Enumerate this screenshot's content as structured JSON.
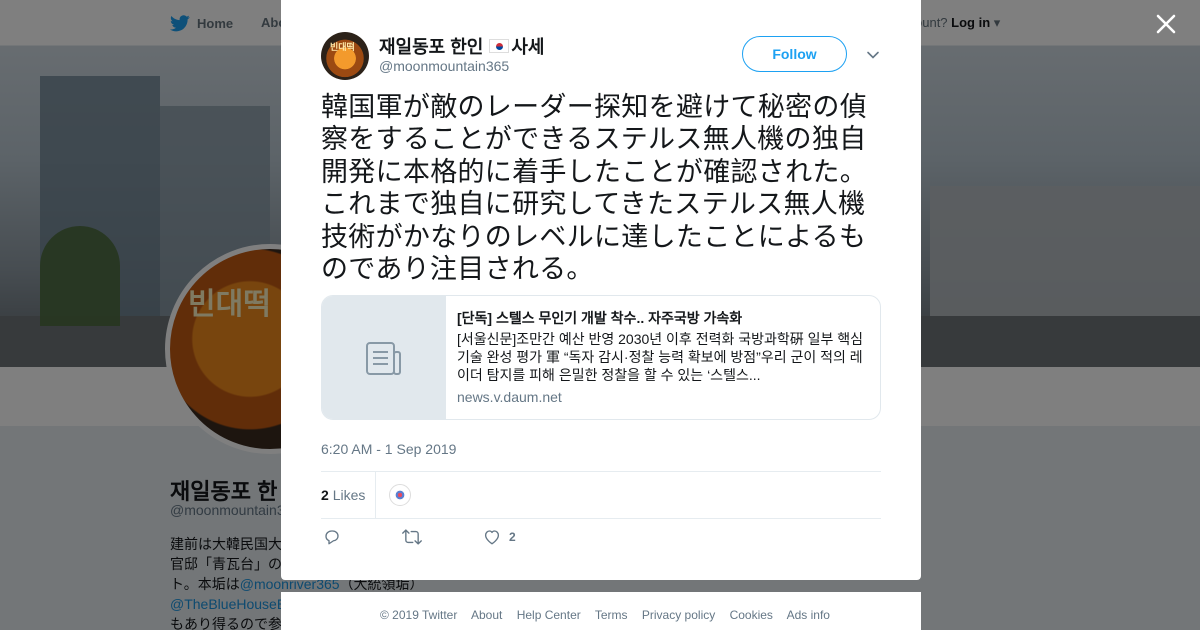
{
  "nav": {
    "home_label": "Home",
    "about_label": "Abo",
    "account_prompt": "ccount?",
    "login_label": "Log in"
  },
  "profile": {
    "display_name": "재일동포 한",
    "handle": "@moonmountain3",
    "bio_lines": [
      "建前は大韓民国大",
      "官邸「青瓦台」の",
      "ト。本垢は"
    ],
    "bio_link1": "@moonriver365",
    "bio_after_link1": "（大統領垢）",
    "bio_link2": "@TheBlueHouseE",
    "bio_last": "もあり得るので参"
  },
  "tweet": {
    "author_name": "재일동포 한인",
    "author_name_suffix": "사세",
    "author_handle": "@moonmountain365",
    "follow_label": "Follow",
    "text": "韓国軍が敵のレーダー探知を避けて秘密の偵察をすることができるステルス無人機の独自開発に本格的に着手したことが確認された。これまで独自に研究してきたステルス無人機技術がかなりのレベルに達したことによるものであり注目される。",
    "card": {
      "title": "[단독] 스텔스 무인기 개발 착수.. 자주국방 가속화",
      "description": "[서울신문]조만간 예산 반영 2030년 이후 전력화 국방과학硏 일부 핵심기술 완성 평가 軍 “독자 감시·정찰 능력 확보에 방점”우리 군이 적의 레이더 탐지를 피해 은밀한 정찰을 할 수 있는 ‘스텔스...",
      "domain": "news.v.daum.net"
    },
    "timestamp": "6:20 AM - 1 Sep 2019",
    "likes_count": "2",
    "likes_label": "Likes",
    "like_action_count": "2"
  },
  "footer": {
    "copyright": "© 2019 Twitter",
    "links": [
      "About",
      "Help Center",
      "Terms",
      "Privacy policy",
      "Cookies",
      "Ads info"
    ]
  },
  "colors": {
    "twitter_blue": "#1da1f2",
    "overlay": "rgba(0,0,0,0.5)",
    "muted_text": "#657786"
  },
  "icons": [
    "twitter-bird-icon",
    "close-icon",
    "chevron-down-icon",
    "link-card-icon",
    "reply-icon",
    "retweet-icon",
    "heart-icon",
    "caret-down-icon"
  ]
}
